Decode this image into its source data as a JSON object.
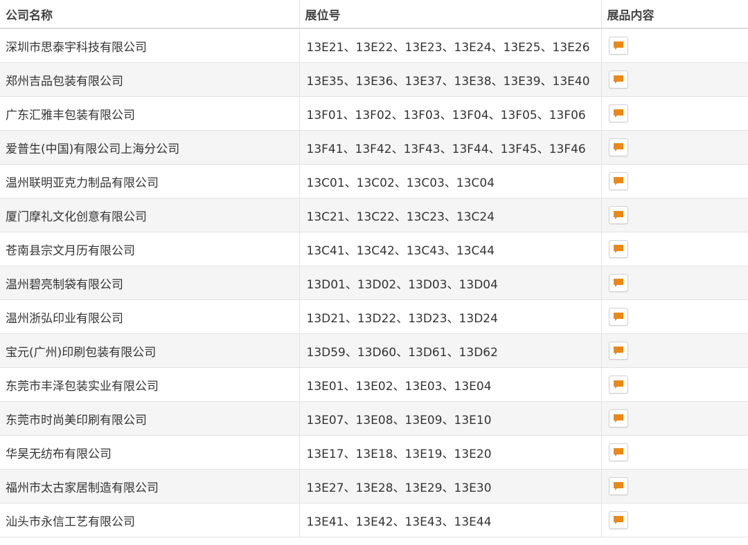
{
  "header": {
    "company": "公司名称",
    "booth": "展位号",
    "products": "展品内容"
  },
  "accent_color": "#e8891a",
  "icon": "chat-bubble-icon",
  "rows": [
    {
      "company": "深圳市思泰宇科技有限公司",
      "booth": "13E21、13E22、13E23、13E24、13E25、13E26"
    },
    {
      "company": "郑州吉品包装有限公司",
      "booth": "13E35、13E36、13E37、13E38、13E39、13E40"
    },
    {
      "company": "广东汇雅丰包装有限公司",
      "booth": "13F01、13F02、13F03、13F04、13F05、13F06"
    },
    {
      "company": "爱普生(中国)有限公司上海分公司",
      "booth": "13F41、13F42、13F43、13F44、13F45、13F46"
    },
    {
      "company": "温州联明亚克力制品有限公司",
      "booth": "13C01、13C02、13C03、13C04"
    },
    {
      "company": "厦门摩礼文化创意有限公司",
      "booth": "13C21、13C22、13C23、13C24"
    },
    {
      "company": "苍南县宗文月历有限公司",
      "booth": "13C41、13C42、13C43、13C44"
    },
    {
      "company": "温州碧亮制袋有限公司",
      "booth": "13D01、13D02、13D03、13D04"
    },
    {
      "company": "温州浙弘印业有限公司",
      "booth": "13D21、13D22、13D23、13D24"
    },
    {
      "company": "宝元(广州)印刷包装有限公司",
      "booth": "13D59、13D60、13D61、13D62"
    },
    {
      "company": "东莞市丰泽包装实业有限公司",
      "booth": "13E01、13E02、13E03、13E04"
    },
    {
      "company": "东莞市时尚美印刷有限公司",
      "booth": "13E07、13E08、13E09、13E10"
    },
    {
      "company": "华昊无纺布有限公司",
      "booth": "13E17、13E18、13E19、13E20"
    },
    {
      "company": "福州市太古家居制造有限公司",
      "booth": "13E27、13E28、13E29、13E30"
    },
    {
      "company": "汕头市永信工艺有限公司",
      "booth": "13E41、13E42、13E43、13E44"
    }
  ]
}
